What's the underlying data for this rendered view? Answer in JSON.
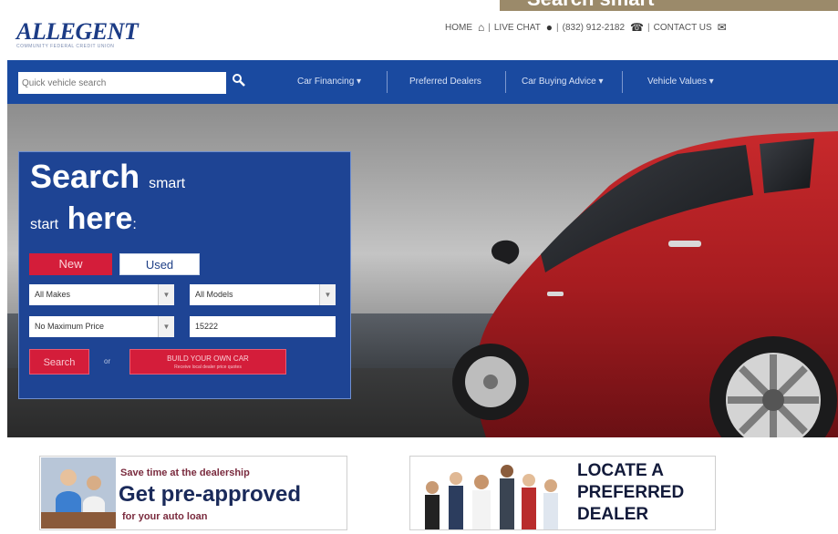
{
  "header": {
    "logo": "ALLEGENT",
    "logo_tagline": "COMMUNITY FEDERAL CREDIT UNION",
    "home": "HOME",
    "live_chat": "LIVE CHAT",
    "phone": "(832) 912-2182",
    "contact": "CONTACT US",
    "corner_text": "Search smart"
  },
  "nav": {
    "search_placeholder": "Quick vehicle search",
    "items": [
      "Car Financing",
      "Preferred Dealers",
      "Car Buying Advice",
      "Vehicle Values"
    ]
  },
  "panel": {
    "title_big": "Search",
    "title_small": "smart",
    "title2_small": "start",
    "title2_big": "here",
    "tab_new": "New",
    "tab_used": "Used",
    "makes": "All Makes",
    "models": "All Models",
    "price": "No Maximum Price",
    "zip": "15222",
    "search_button": "Search",
    "or": "or",
    "build_button": "BUILD YOUR OWN CAR",
    "build_sub": "Receive local dealer price quotes"
  },
  "banners": {
    "preapproved_small": "Save time at the dealership",
    "preapproved_big": "Get pre-approved",
    "preapproved_sub": "for your auto loan",
    "dealer_line1": "LOCATE A",
    "dealer_line2": "PREFERRED",
    "dealer_line3": "DEALER"
  },
  "colors": {
    "brand_blue": "#1a4aa0",
    "panel_blue": "#1e4494",
    "accent_red": "#d41d3a",
    "car_red": "#b01e22"
  },
  "icons": [
    "home-icon",
    "chat-icon",
    "phone-icon",
    "mail-icon",
    "search-icon",
    "chevron-down-icon"
  ]
}
